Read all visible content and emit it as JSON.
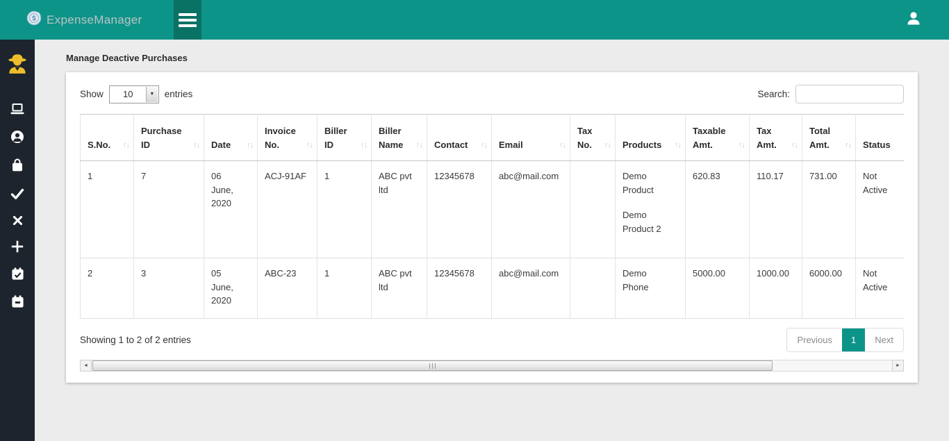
{
  "header": {
    "app_name": "ExpenseManager",
    "logo_icon": "dollar-coin-icon",
    "menu_icon": "hamburger-icon",
    "user_icon": "user-icon"
  },
  "sidebar": {
    "items": [
      {
        "icon": "spy-icon",
        "color": "#EDBE2A"
      },
      {
        "icon": "laptop-icon"
      },
      {
        "icon": "user-circle-icon"
      },
      {
        "icon": "shopping-bag-icon"
      },
      {
        "icon": "check-icon"
      },
      {
        "icon": "close-icon"
      },
      {
        "icon": "plus-icon"
      },
      {
        "icon": "calendar-check-icon"
      },
      {
        "icon": "calendar-slot-icon"
      }
    ]
  },
  "page": {
    "title": "Manage Deactive Purchases"
  },
  "controls": {
    "show_label": "Show",
    "page_length": "10",
    "entries_label": "entries",
    "search_label": "Search:",
    "search_value": ""
  },
  "icons": {
    "sort_asc": "↑",
    "sort_desc": "↓",
    "select_arrow": "▼",
    "scroll_left": "◄",
    "scroll_right": "►"
  },
  "table": {
    "columns": [
      "S.No.",
      "Purchase ID",
      "Date",
      "Invoice No.",
      "Biller ID",
      "Biller Name",
      "Contact",
      "Email",
      "Tax No.",
      "Products",
      "Taxable Amt.",
      "Tax Amt.",
      "Total Amt.",
      "Status"
    ],
    "rows": [
      [
        "1",
        "7",
        "06 June, 2020",
        "ACJ-91AF",
        "1",
        "ABC pvt ltd",
        "12345678",
        "abc@mail.com",
        "",
        [
          "Demo Product",
          "Demo Product 2"
        ],
        "620.83",
        "110.17",
        "731.00",
        "Not Active"
      ],
      [
        "2",
        "3",
        "05 June, 2020",
        "ABC-23",
        "1",
        "ABC pvt ltd",
        "12345678",
        "abc@mail.com",
        "",
        [
          "Demo Phone"
        ],
        "5000.00",
        "1000.00",
        "6000.00",
        "Not Active"
      ]
    ]
  },
  "footer": {
    "info": "Showing 1 to 2 of 2 entries",
    "pagination": {
      "previous": "Previous",
      "current": "1",
      "next": "Next"
    }
  },
  "colors": {
    "header_teal": "#0D9488",
    "header_dark_teal": "#0A7265",
    "sidebar_dark": "#1D242D",
    "accent_teal": "#0D9488",
    "spy_yellow": "#EDBE2A"
  }
}
